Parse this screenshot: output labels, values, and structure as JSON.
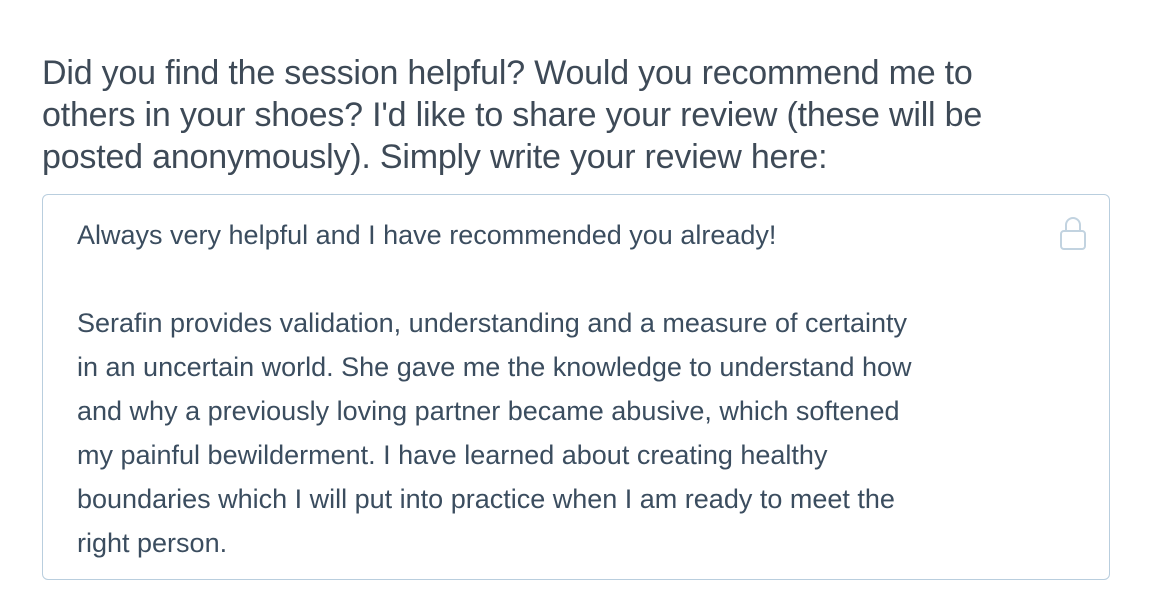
{
  "prompt": {
    "text": "Did you find the session helpful? Would you recommend me to\nothers in your shoes? I'd like to share your review (these will be\nposted anonymously). Simply write your review here:"
  },
  "review": {
    "value": "Always very helpful and I have recommended you already!\n\nSerafin provides validation, understanding and a measure of certainty\nin an uncertain world. She gave me the knowledge to understand how\nand why a previously loving partner became abusive, which softened\nmy painful bewilderment. I have learned about creating healthy\nboundaries which I will put into practice when I am ready to meet the\nright person.",
    "lock_icon": "lock-icon"
  },
  "colors": {
    "prompt_text": "#3e4a57",
    "review_text": "#3b4d5f",
    "box_border": "#b9cede",
    "lock_icon": "#c2d3e0"
  }
}
